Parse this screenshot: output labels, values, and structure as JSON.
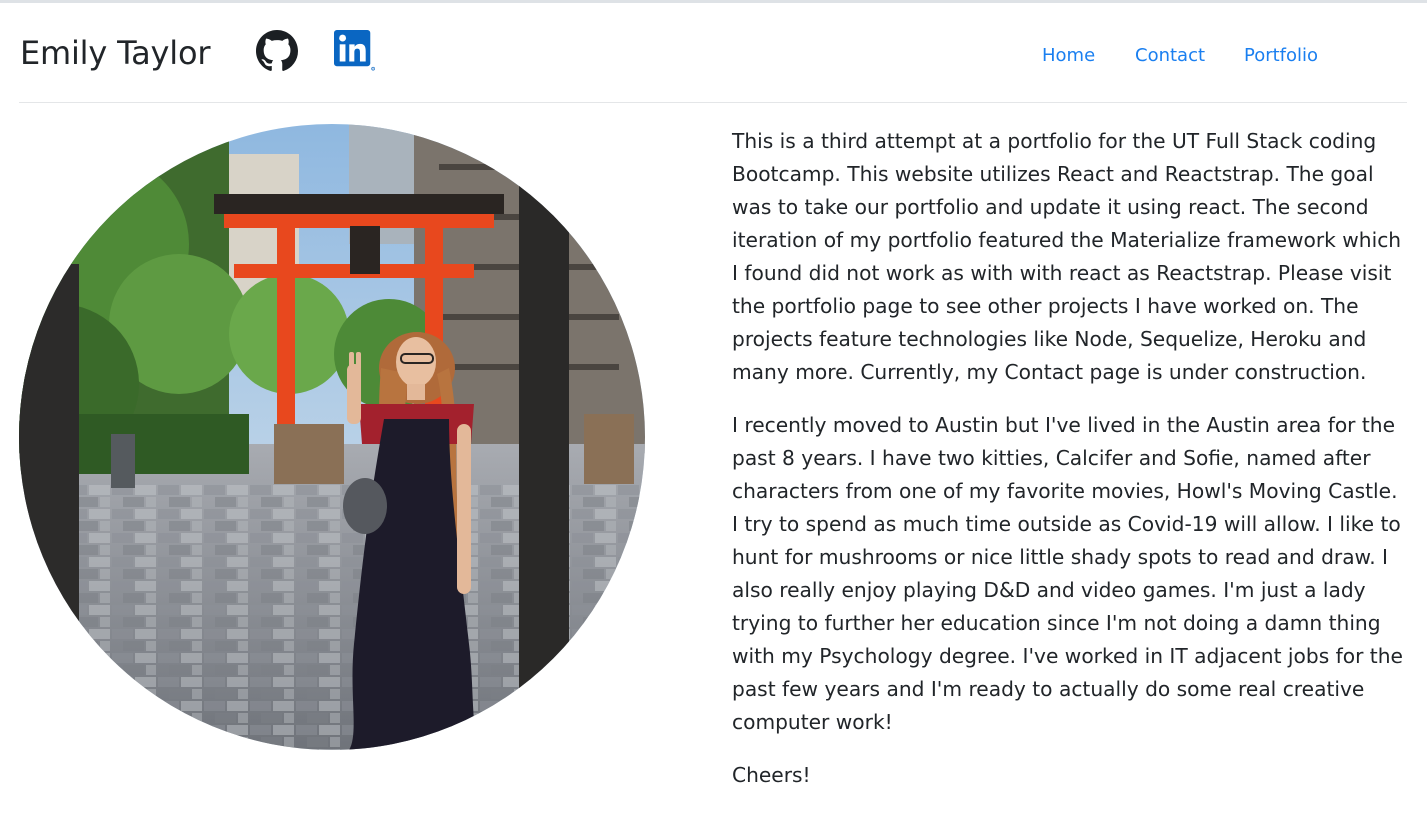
{
  "header": {
    "brand": "Emily Taylor",
    "icons": [
      "github-icon",
      "linkedin-icon"
    ]
  },
  "nav": {
    "items": [
      {
        "label": "Home"
      },
      {
        "label": "Contact"
      },
      {
        "label": "Portfolio"
      }
    ],
    "link_color": "#1a7ff0"
  },
  "main": {
    "photo": "profile-photo",
    "paragraphs": [
      "This is a third attempt at a portfolio for the UT Full Stack coding Bootcamp. This website utilizes React and Reactstrap. The goal was to take our portfolio and update it using react. The second iteration of my portfolio featured the Materialize framework which I found did not work as with with react as Reactstrap. Please visit the portfolio page to see other projects I have worked on. The projects feature technologies like Node, Sequelize, Heroku and many more. Currently, my Contact page is under construction.",
      "I recently moved to Austin but I've lived in the Austin area for the past 8 years. I have two kitties, Calcifer and Sofie, named after characters from one of my favorite movies, Howl's Moving Castle. I try to spend as much time outside as Covid-19 will allow. I like to hunt for mushrooms or nice little shady spots to read and draw. I also really enjoy playing D&D and video games. I'm just a lady trying to further her education since I'm not doing a damn thing with my Psychology degree. I've worked in IT adjacent jobs for the past few years and I'm ready to actually do some real creative computer work!",
      "Cheers!"
    ]
  },
  "colors": {
    "text": "#212529",
    "linkedin_blue": "#0a66c2",
    "torii_red": "#e8481e"
  }
}
